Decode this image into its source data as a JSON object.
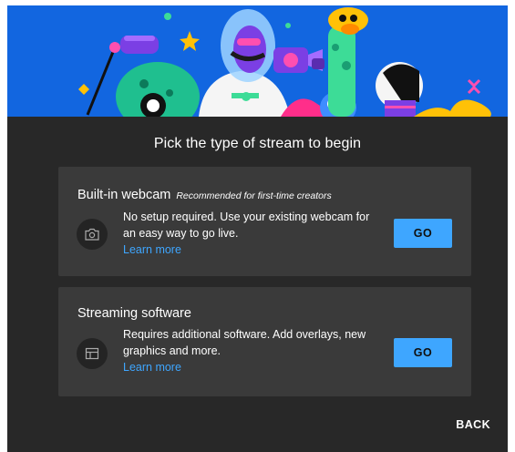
{
  "dialog": {
    "title": "Pick the type of stream to begin",
    "back_label": "BACK"
  },
  "options": [
    {
      "title": "Built-in webcam",
      "note": "Recommended for first-time creators",
      "description": "No setup required. Use your existing webcam for an easy way to go live.",
      "learn_more": "Learn more",
      "button": "GO",
      "icon": "camera-icon"
    },
    {
      "title": "Streaming software",
      "note": "",
      "description": "Requires additional software. Add overlays, new graphics and more.",
      "learn_more": "Learn more",
      "button": "GO",
      "icon": "broadcast-window-icon"
    }
  ],
  "colors": {
    "hero_background": "#1266e0",
    "dialog_background": "#282828",
    "card_background": "#3a3a3a",
    "accent": "#3ea6ff"
  }
}
